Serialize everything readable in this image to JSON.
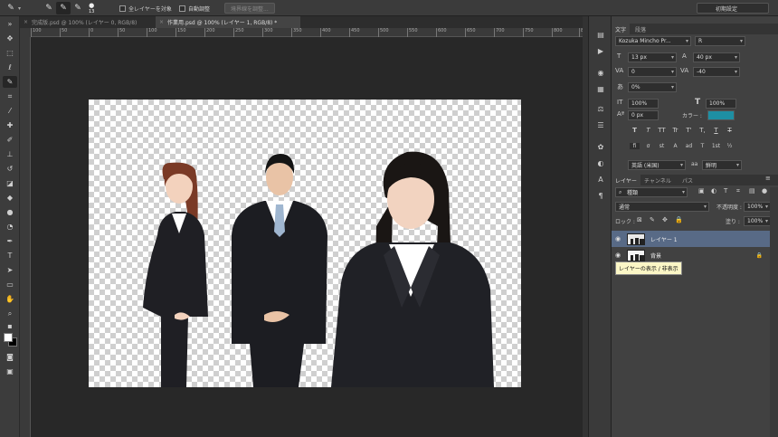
{
  "options_bar": {
    "brush_size": "13",
    "sample_all_layers_label": "全レイヤーを対象",
    "auto_enhance_label": "自動調整",
    "refine_edge_label": "境界線を調整...",
    "workspace": "初期設定"
  },
  "tabs": [
    {
      "label": "完成版.psd @ 100% (レイヤー 0, RGB/8)"
    },
    {
      "label": "作業用.psd @ 100% (レイヤー 1, RGB/8) *"
    }
  ],
  "ruler": {
    "ticks": [
      "100",
      "50",
      "0",
      "50",
      "100",
      "150",
      "200",
      "250",
      "300",
      "350",
      "400",
      "450",
      "500",
      "550",
      "600",
      "650",
      "700",
      "750",
      "800",
      "850"
    ]
  },
  "character_panel": {
    "tabs": [
      "文字",
      "段落"
    ],
    "font_family": "Kozuka Mincho Pr...",
    "font_style": "R",
    "font_size": "13 px",
    "leading": "40 px",
    "kerning": "0",
    "tracking": "-40",
    "tsume": "0%",
    "vertical_scale": "100%",
    "horizontal_scale": "100%",
    "baseline_shift": "0 px",
    "color_label": "カラー :",
    "color_value": "#1e8fa3",
    "format_buttons": [
      "T",
      "T",
      "TT",
      "Tr",
      "T'",
      "T,",
      "T",
      "T"
    ],
    "opentype_buttons": [
      "fi",
      "σ",
      "st",
      "A",
      "ad",
      "T",
      "1st",
      "½"
    ],
    "language": "英語 (米国)",
    "antialias_prefix": "aa",
    "antialias": "鮮明"
  },
  "layers_panel": {
    "tabs": [
      "レイヤー",
      "チャンネル",
      "パス"
    ],
    "filter_kind": "種類",
    "blend_mode": "通常",
    "opacity_label": "不透明度 :",
    "opacity": "100%",
    "lock_label": "ロック :",
    "fill_label": "塗り :",
    "fill": "100%",
    "layers": [
      {
        "name": "レイヤー 1",
        "selected": true
      },
      {
        "name": "背景",
        "selected": false
      }
    ],
    "tooltip": "レイヤーの表示 / 非表示"
  }
}
